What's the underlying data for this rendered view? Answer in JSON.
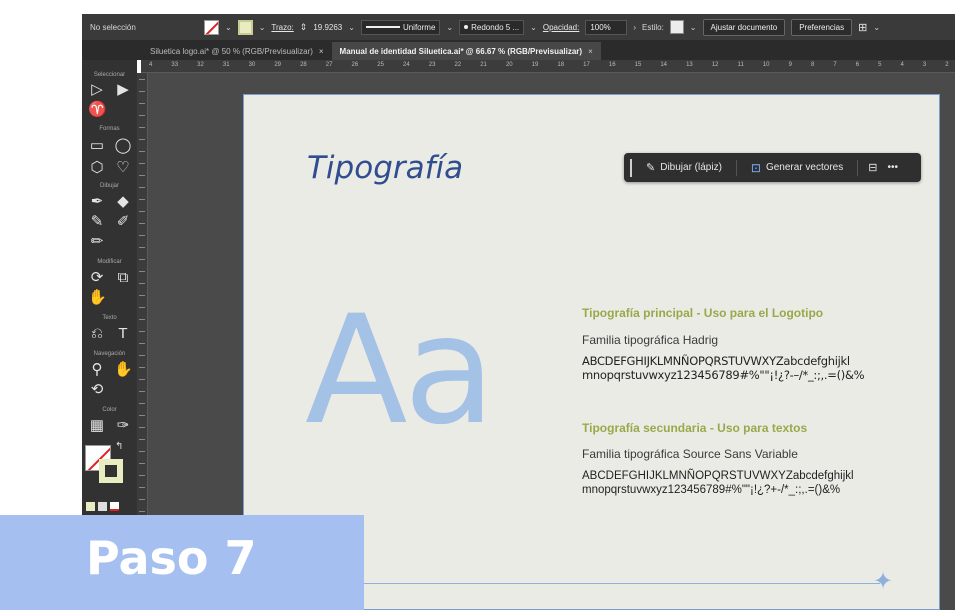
{
  "control_bar": {
    "selection": "No selección",
    "stroke_label": "Trazo:",
    "stroke_value": "19.9263",
    "profile": "Uniforme",
    "brush": "Redondo 5 ...",
    "opacity_label": "Opacidad:",
    "opacity_value": "100%",
    "style_label": "Estilo:",
    "fit_button": "Ajustar documento",
    "prefs_button": "Preferencias"
  },
  "tabs": [
    {
      "label": "Siluetica logo.ai* @ 50 % (RGB/Previsualizar)",
      "close": "×"
    },
    {
      "label": "Manual de identidad Siluetica.ai* @ 66.67 % (RGB/Previsualizar)",
      "close": "×"
    }
  ],
  "ruler_ticks": [
    "4",
    "33",
    "32",
    "31",
    "30",
    "29",
    "28",
    "27",
    "26",
    "25",
    "24",
    "23",
    "22",
    "21",
    "20",
    "19",
    "18",
    "17",
    "16",
    "15",
    "14",
    "13",
    "12",
    "11",
    "10",
    "9",
    "8",
    "7",
    "6",
    "5",
    "4",
    "3",
    "2"
  ],
  "tool_groups": {
    "select": "Seleccionar",
    "shapes": "Formas",
    "draw": "Dibujar",
    "modify": "Modificar",
    "text": "Texto",
    "navigation": "Navegación",
    "color": "Color"
  },
  "artboard": {
    "title": "Tipografía",
    "big_letters": "Aa"
  },
  "context_bar": {
    "draw_label": "Dibujar (lápiz)",
    "generate_label": "Generar vectores",
    "more": "•••"
  },
  "primary_font": {
    "heading": "Tipografía principal -  Uso para el Logotipo",
    "family": "Familia tipográfica Hadrig",
    "line1": "ABCDEFGHIJKLMNÑOPQRSTUVWXYZabcdefghijkl",
    "line2": "mnopqrstuvwxyz123456789#%\"\"¡!¿?-–/*_:;,.=()&%"
  },
  "secondary_font": {
    "heading": "Tipografía secundaria -  Uso para textos",
    "family": "Familia tipográfica Source Sans Variable",
    "line1": "ABCDEFGHIJKLMNÑOPQRSTUVWXYZabcdefghijkl",
    "line2": "mnopqrstuvwxyz123456789#%\"\"¡!¿?+-/*_:;,.=()&%"
  },
  "step": {
    "label": "Paso 7"
  },
  "colors": {
    "title_blue": "#2f4d8f",
    "aa_blue": "#a4c1e6",
    "heading_olive": "#9aa84b",
    "banner_blue": "#a5bff0",
    "artboard_bg": "#ebebe6"
  }
}
